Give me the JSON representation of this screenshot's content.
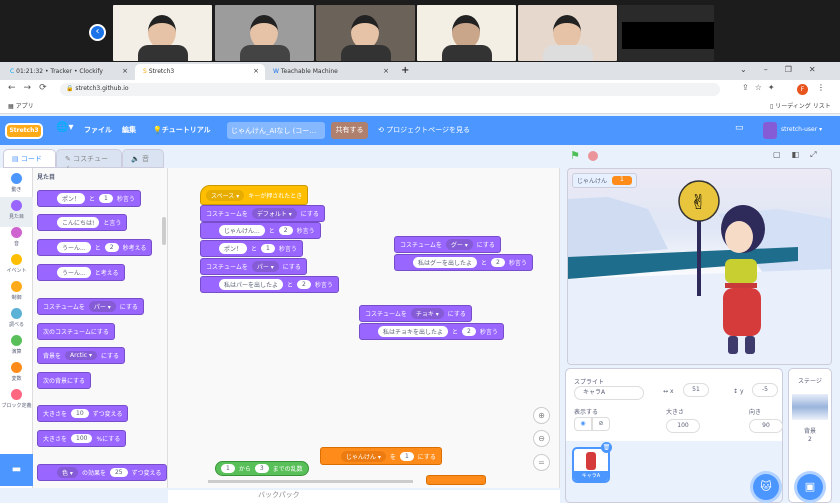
{
  "video_call": {
    "participants": [
      "participant-1",
      "participant-2",
      "participant-3",
      "participant-4",
      "participant-5",
      "participant-6"
    ]
  },
  "browser": {
    "tabs": [
      {
        "label": "01:21:32 • Tracker • Clockify",
        "icon": "C"
      },
      {
        "label": "Stretch3",
        "icon": "S"
      },
      {
        "label": "Teachable Machine",
        "icon": "W"
      }
    ],
    "new_tab": "+",
    "url": "stretch3.github.io",
    "bookmarks_apps": "アプリ",
    "reading_list": "リーディング リスト",
    "profile_initial": "F"
  },
  "menubar": {
    "logo": "Stretch3",
    "file": "ファイル",
    "edit": "編集",
    "tutorial": "チュートリアル",
    "project_title": "じゃんけん_AIなし (コー…",
    "share": "共有する",
    "project_page": "プロジェクトページを見る",
    "user": "stretch-user"
  },
  "editor_tabs": {
    "code": "コード",
    "costumes": "コスチューム",
    "sounds": "音"
  },
  "categories": [
    {
      "label": "動き",
      "color": "#4c97ff"
    },
    {
      "label": "見た目",
      "color": "#9966ff"
    },
    {
      "label": "音",
      "color": "#cf63cf"
    },
    {
      "label": "イベント",
      "color": "#ffbf00"
    },
    {
      "label": "制御",
      "color": "#ffab19"
    },
    {
      "label": "調べる",
      "color": "#5cb1d6"
    },
    {
      "label": "演算",
      "color": "#59c059"
    },
    {
      "label": "変数",
      "color": "#ff8c1a"
    },
    {
      "label": "ブロック定義",
      "color": "#ff6680"
    }
  ],
  "palette": {
    "heading": "見た目",
    "b1": {
      "a": "ポン！",
      "b": "と",
      "c": "1",
      "d": "秒言う"
    },
    "b2": {
      "a": "こんにちは!",
      "b": "と言う"
    },
    "b3": {
      "a": "うーん...",
      "b": "と",
      "c": "2",
      "d": "秒考える"
    },
    "b4": {
      "a": "うーん...",
      "b": "と考える"
    },
    "b5": {
      "a": "コスチュームを",
      "b": "パー",
      "c": "にする"
    },
    "b6": {
      "a": "次のコスチュームにする"
    },
    "b7": {
      "a": "背景を",
      "b": "Arctic",
      "c": "にする"
    },
    "b8": {
      "a": "次の背景にする"
    },
    "b9": {
      "a": "大きさを",
      "b": "10",
      "c": "ずつ変える"
    },
    "b10": {
      "a": "大きさを",
      "b": "100",
      "c": "%にする"
    },
    "b11": {
      "a": "色",
      "b": "の効果を",
      "c": "25",
      "d": "ずつ変える"
    }
  },
  "scripts": {
    "hat": {
      "a": "スペース",
      "b": "キーが押されたとき"
    },
    "s1": {
      "a": "コスチュームを",
      "b": "デフォルト",
      "c": "にする"
    },
    "s2": {
      "a": "じゃんけん...",
      "b": "と",
      "c": "2",
      "d": "秒言う"
    },
    "s3": {
      "a": "ポン！",
      "b": "と",
      "c": "1",
      "d": "秒言う"
    },
    "s4": {
      "a": "コスチュームを",
      "b": "パー",
      "c": "にする"
    },
    "s5": {
      "a": "私はパーを出したよ",
      "b": "と",
      "c": "2",
      "d": "秒言う"
    },
    "g1": {
      "a": "コスチュームを",
      "b": "グー",
      "c": "にする"
    },
    "g2": {
      "a": "私はグーを出したよ",
      "b": "と",
      "c": "2",
      "d": "秒言う"
    },
    "c1": {
      "a": "コスチュームを",
      "b": "チョキ",
      "c": "にする"
    },
    "c2": {
      "a": "私はチョキを出したよ",
      "b": "と",
      "c": "2",
      "d": "秒言う"
    },
    "v1": {
      "a": "じゃんけん",
      "b": "を",
      "c": "1",
      "d": "にする"
    },
    "r1": {
      "a": "1",
      "b": "から",
      "c": "3",
      "d": "までの乱数"
    }
  },
  "backpack": "バックパック",
  "stage": {
    "monitor_label": "じゃんけん",
    "monitor_value": "1"
  },
  "sprite": {
    "label_sprite": "スプライト",
    "name": "キャラA",
    "x_label": "x",
    "x": "51",
    "y_label": "y",
    "y": "-5",
    "show_label": "表示する",
    "size_label": "大きさ",
    "size": "100",
    "direction_label": "向き",
    "direction": "90",
    "thumb_label": "キャラA"
  },
  "stage_pane": {
    "title": "ステージ",
    "backdrops_label": "背景",
    "backdrops_count": "2"
  }
}
